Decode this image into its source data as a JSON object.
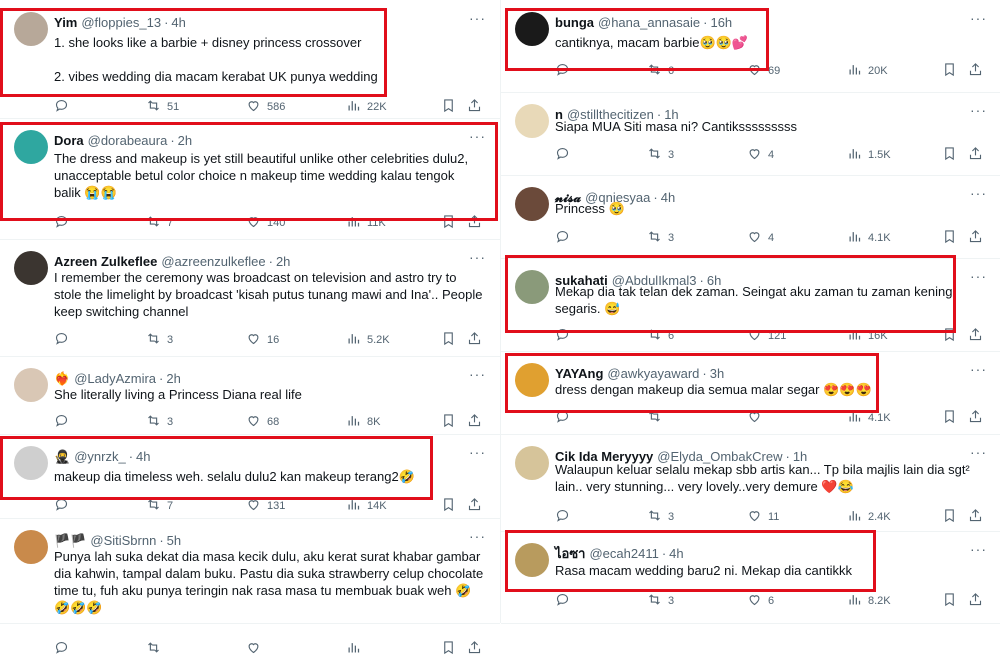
{
  "left_column": [
    {
      "name": "Yim",
      "handle": "@floppies_13",
      "time": "4h",
      "text": "1. she looks like a barbie + disney princess crossover\n\n2. vibes wedding dia macam kerabat UK punya wedding",
      "stats": {
        "replies": "",
        "retweets": "51",
        "likes": "586",
        "views": "22K"
      },
      "avatar_color": "#b7a899"
    },
    {
      "name": "Dora",
      "handle": "@dorabeaura",
      "time": "2h",
      "text": "The dress and makeup is yet still beautiful unlike other celebrities dulu2, unacceptable betul color choice n makeup time wedding kalau tengok balik 😭😭",
      "stats": {
        "replies": "",
        "retweets": "7",
        "likes": "140",
        "views": "11K"
      },
      "avatar_color": "#2fa7a0"
    },
    {
      "name": "Azreen Zulkeflee",
      "handle": "@azreenzulkeflee",
      "time": "2h",
      "text": "I remember the ceremony was broadcast on television and astro try to stole the limelight by broadcast 'kisah putus tunang mawi and Ina'.. People keep switching channel",
      "stats": {
        "replies": "",
        "retweets": "3",
        "likes": "16",
        "views": "5.2K"
      },
      "avatar_color": "#3b3530"
    },
    {
      "name": "❤️‍🔥",
      "handle": "@LadyAzmira",
      "time": "2h",
      "text": "She literally living a Princess Diana real life",
      "stats": {
        "replies": "",
        "retweets": "3",
        "likes": "68",
        "views": "8K"
      },
      "avatar_color": "#d9c7b5"
    },
    {
      "name": "🥷",
      "handle": "@ynrzk_",
      "time": "4h",
      "text": "makeup dia timeless weh. selalu dulu2 kan makeup terang2🤣",
      "stats": {
        "replies": "",
        "retweets": "7",
        "likes": "131",
        "views": "14K"
      },
      "avatar_color": "#cfcfcf"
    },
    {
      "name": "🏴🏴",
      "handle": "@SitiSbrnn",
      "time": "5h",
      "text": "Punya lah suka dekat dia masa kecik dulu, aku kerat surat khabar gambar dia kahwin, tampal dalam buku. Pastu dia suka strawberry celup chocolate time tu, fuh aku punya teringin nak rasa masa tu membuak buak weh 🤣🤣🤣🤣",
      "stats": {
        "replies": "",
        "retweets": "",
        "likes": "",
        "views": ""
      },
      "avatar_color": "#c98a4b"
    }
  ],
  "right_column": [
    {
      "name": "bunga",
      "handle": "@hana_annasaie",
      "time": "16h",
      "text": "cantiknya, macam barbie🥹🥹💕",
      "stats": {
        "replies": "",
        "retweets": "6",
        "likes": "69",
        "views": "20K"
      },
      "avatar_color": "#1a1a1a"
    },
    {
      "name": "n",
      "handle": "@stillthecitizen",
      "time": "1h",
      "text": "Siapa MUA Siti masa ni? Cantiksssssssss",
      "stats": {
        "replies": "",
        "retweets": "3",
        "likes": "4",
        "views": "1.5K"
      },
      "avatar_color": "#e8d9b8"
    },
    {
      "name": "𝓷𝓲𝓼𝓪",
      "handle": "@qniesyaa",
      "time": "4h",
      "text": "Princess 🥹",
      "stats": {
        "replies": "",
        "retweets": "3",
        "likes": "4",
        "views": "4.1K"
      },
      "avatar_color": "#6b4a3a"
    },
    {
      "name": "sukahati",
      "handle": "@AbdulIkmal3",
      "time": "6h",
      "text": "Mekap dia tak telan dek zaman. Seingat aku zaman tu zaman kening segaris. 😅",
      "stats": {
        "replies": "",
        "retweets": "6",
        "likes": "121",
        "views": "16K"
      },
      "avatar_color": "#8a9a7a"
    },
    {
      "name": "YAYAng",
      "handle": "@awkyayaward",
      "time": "3h",
      "text": "dress dengan makeup dia semua malar segar 😍😍😍",
      "stats": {
        "replies": "",
        "retweets": "",
        "likes": "",
        "views": "4.1K"
      },
      "avatar_color": "#e0a030"
    },
    {
      "name": "Cik Ida Meryyyy",
      "handle": "@Elyda_OmbakCrew",
      "time": "1h",
      "text": "Walaupun keluar selalu mekap sbb artis kan... Tp bila majlis lain dia sgt² lain.. very stunning... very lovely..very demure ❤️😂",
      "stats": {
        "replies": "",
        "retweets": "3",
        "likes": "11",
        "views": "2.4K"
      },
      "avatar_color": "#d6c49a"
    },
    {
      "name": "ไอซา",
      "handle": "@ecah2411",
      "time": "4h",
      "text": "Rasa macam wedding baru2 ni. Mekap dia cantikkk",
      "stats": {
        "replies": "",
        "retweets": "3",
        "likes": "6",
        "views": "8.2K"
      },
      "avatar_color": "#b89b5e"
    }
  ],
  "colors": {
    "highlight": "#e10e1b",
    "muted": "#536471",
    "divider": "#eff3f4"
  }
}
